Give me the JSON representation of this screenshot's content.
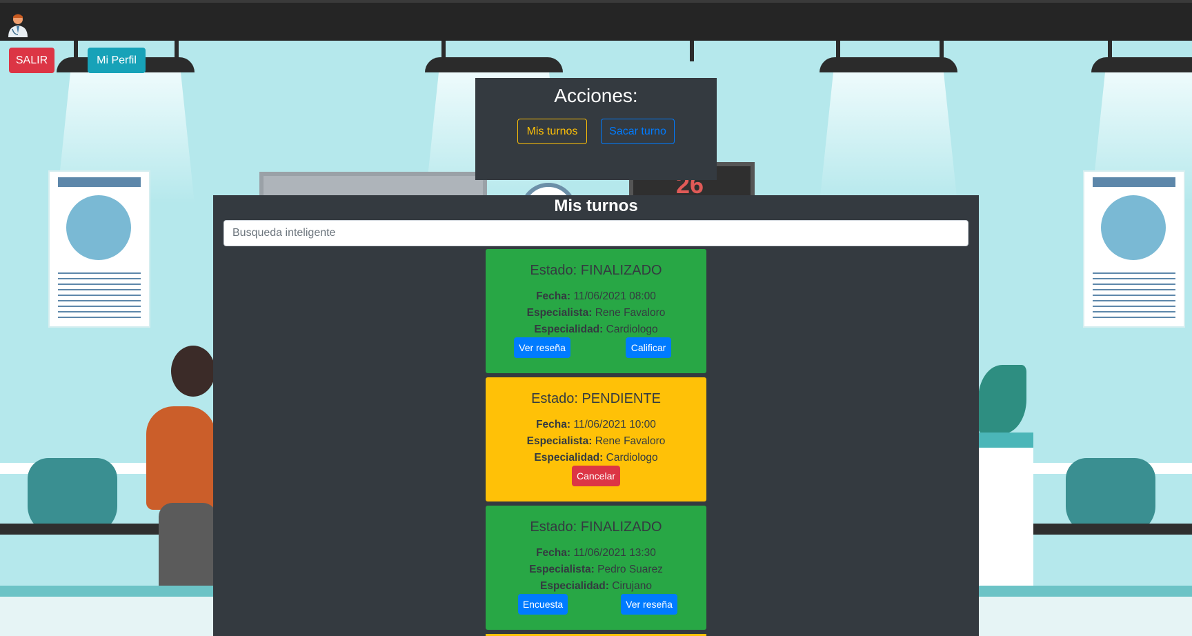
{
  "nav": {
    "logo_icon": "doctor-avatar-icon"
  },
  "top_buttons": {
    "salir": "SALIR",
    "perfil": "Mi Perfil"
  },
  "acciones": {
    "title": "Acciones:",
    "mis_turnos": "Mis turnos",
    "sacar_turno": "Sacar turno"
  },
  "background": {
    "board_number": "26"
  },
  "turnos": {
    "title": "Mis turnos",
    "search_placeholder": "Busqueda inteligente",
    "labels": {
      "fecha": "Fecha:",
      "especialista": "Especialista:",
      "especialidad": "Especialidad:"
    },
    "cards": [
      {
        "estado": "Estado: FINALIZADO",
        "fecha": "11/06/2021 08:00",
        "especialista": "Rene Favaloro",
        "especialidad": "Cardiologo",
        "color": "#28a745",
        "buttons": [
          "Ver reseña",
          "Calificar"
        ]
      },
      {
        "estado": "Estado: PENDIENTE",
        "fecha": "11/06/2021 10:00",
        "especialista": "Rene Favaloro",
        "especialidad": "Cardiologo",
        "color": "#ffc107",
        "buttons": [
          "Cancelar"
        ]
      },
      {
        "estado": "Estado: FINALIZADO",
        "fecha": "11/06/2021 13:30",
        "especialista": "Pedro Suarez",
        "especialidad": "Cirujano",
        "color": "#28a745",
        "buttons": [
          "Encuesta",
          "Ver reseña"
        ]
      }
    ]
  }
}
